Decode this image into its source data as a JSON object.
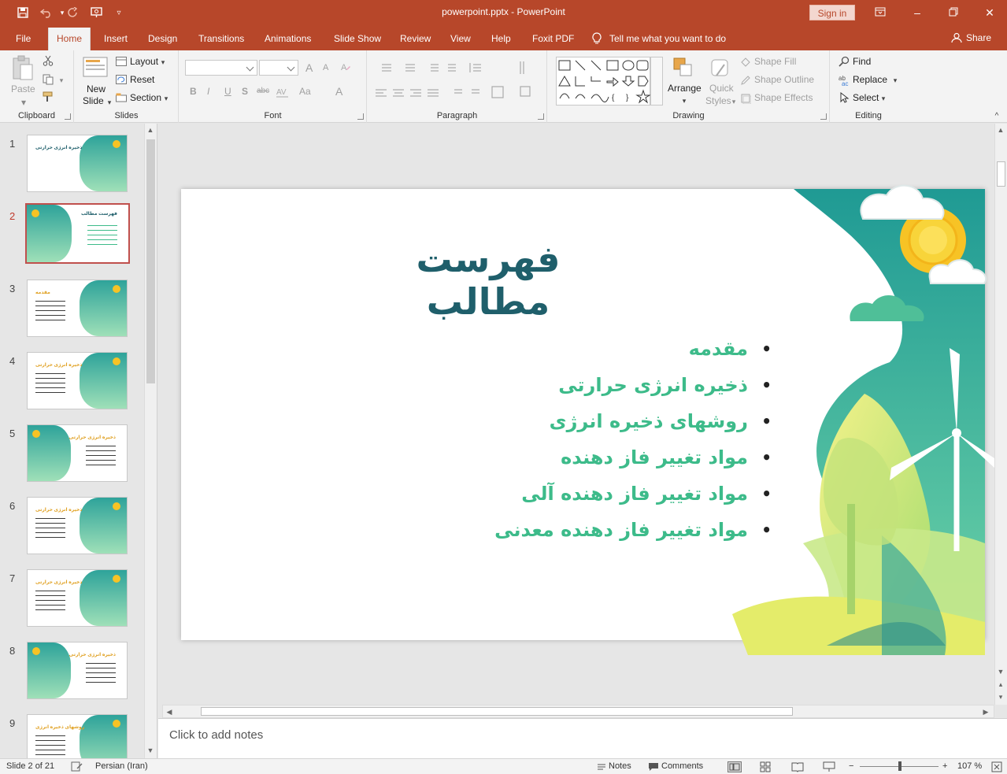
{
  "window": {
    "title": "powerpoint.pptx  -  PowerPoint",
    "sign_in": "Sign in"
  },
  "tabs": [
    "File",
    "Home",
    "Insert",
    "Design",
    "Transitions",
    "Animations",
    "Slide Show",
    "Review",
    "View",
    "Help",
    "Foxit PDF"
  ],
  "active_tab": "Home",
  "tell_me": "Tell me what you want to do",
  "share": "Share",
  "ribbon": {
    "clipboard": {
      "label": "Clipboard",
      "paste": "Paste"
    },
    "slides": {
      "label": "Slides",
      "new_slide": "New",
      "new_slide_2": "Slide",
      "layout": "Layout",
      "reset": "Reset",
      "section": "Section"
    },
    "font": {
      "label": "Font",
      "bold": "B",
      "italic": "I",
      "underline": "U",
      "shadow": "S",
      "strike": "abc",
      "font_size_up": "A",
      "font_size_down": "A",
      "change_case": "Aa",
      "clear": "A"
    },
    "paragraph": {
      "label": "Paragraph"
    },
    "drawing": {
      "label": "Drawing",
      "arrange": "Arrange",
      "quick_styles": "Quick",
      "quick_styles_2": "Styles",
      "shape_fill": "Shape Fill",
      "shape_outline": "Shape Outline",
      "shape_effects": "Shape Effects"
    },
    "editing": {
      "label": "Editing",
      "find": "Find",
      "replace": "Replace",
      "select": "Select"
    }
  },
  "thumbnails": [
    {
      "num": "1",
      "title": "ذخیره انرژی حرارتی"
    },
    {
      "num": "2",
      "title": "فهرست مطالب"
    },
    {
      "num": "3",
      "title": "مقدمه"
    },
    {
      "num": "4",
      "title": "ذخیره انرژی حرارتی"
    },
    {
      "num": "5",
      "title": "ذخیره انرژی حرارتی"
    },
    {
      "num": "6",
      "title": "ذخیره انرژی حرارتی"
    },
    {
      "num": "7",
      "title": "ذخیره انرژی حرارتی"
    },
    {
      "num": "8",
      "title": "ذخیره انرژی حرارتی"
    },
    {
      "num": "9",
      "title": "روشهای ذخیره انرژی"
    }
  ],
  "slide": {
    "title": "فهرست مطالب",
    "bullets": [
      "مقدمه",
      "ذخیره انرژی حرارتی",
      "روشهای ذخیره انرژی",
      "مواد تغییر فاز دهنده",
      "مواد تغییر فاز دهنده آلی",
      "مواد تغییر فاز دهنده معدنی"
    ]
  },
  "notes_placeholder": "Click to add notes",
  "status": {
    "slide_info": "Slide 2 of 21",
    "language": "Persian (Iran)",
    "notes": "Notes",
    "comments": "Comments",
    "zoom": "107 %"
  },
  "colors": {
    "accent": "#b7472a",
    "slide_title": "#1f5f6b",
    "bullet_text": "#3dbb8a",
    "teal": "#2ea39a",
    "green": "#7fd6b0",
    "yellow": "#e2ec7a",
    "sun": "#f7c325"
  }
}
